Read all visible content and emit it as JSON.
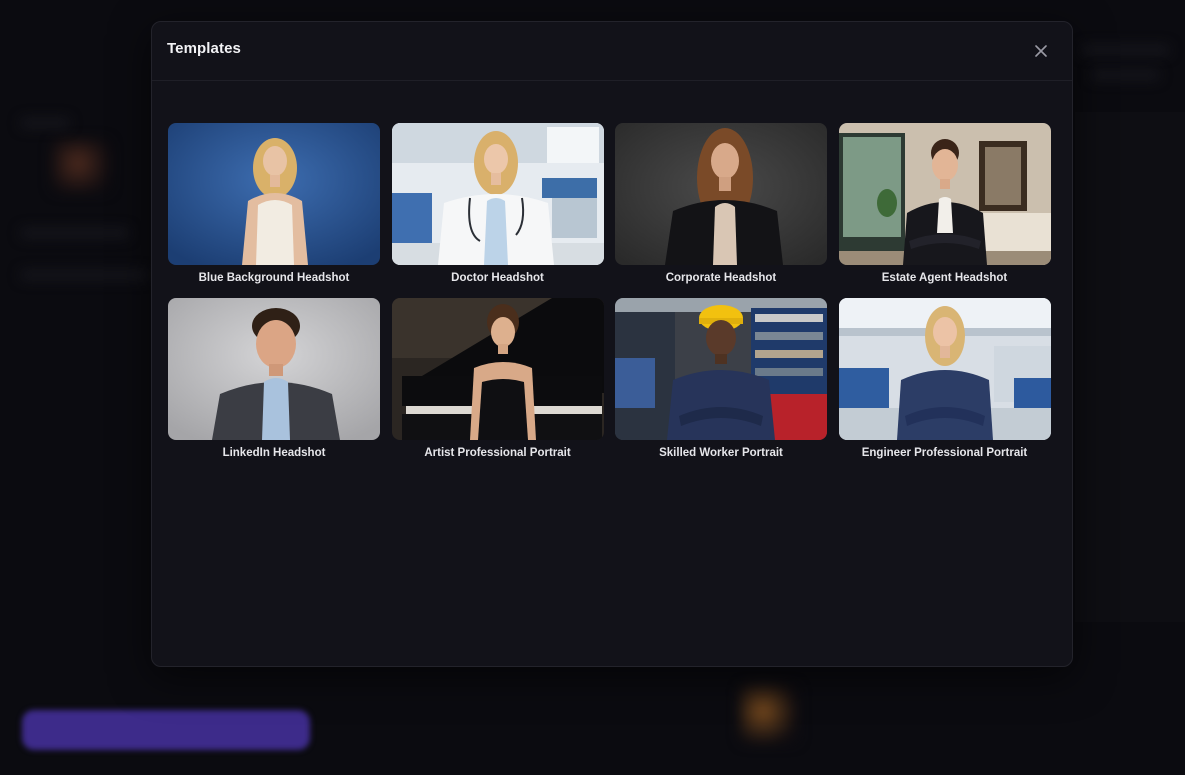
{
  "modal": {
    "title": "Templates",
    "close_icon": "close-icon"
  },
  "templates": [
    {
      "label": "Blue Background Headshot"
    },
    {
      "label": "Doctor Headshot"
    },
    {
      "label": "Corporate Headshot"
    },
    {
      "label": "Estate Agent Headshot"
    },
    {
      "label": "LinkedIn Headshot"
    },
    {
      "label": "Artist Professional Portrait"
    },
    {
      "label": "Skilled Worker Portrait"
    },
    {
      "label": "Engineer Professional Portrait"
    }
  ],
  "colors": {
    "modal_bg": "#121219",
    "overlay_bg": "#0b0b10",
    "accent_purple": "#3d2b8a"
  }
}
